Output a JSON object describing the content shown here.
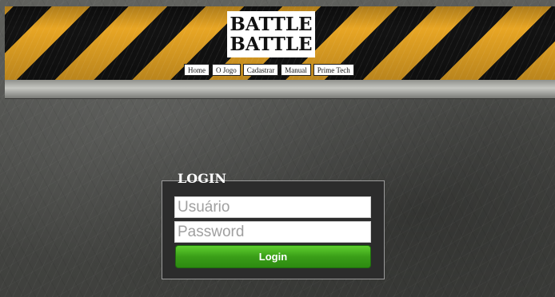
{
  "header": {
    "logo_line1": "BATTLE",
    "logo_line2": "BATTLE",
    "nav": [
      "Home",
      "O Jogo",
      "Cadastrar",
      "Manual",
      "Prime Tech"
    ],
    "stripe_colors": [
      "#e8a624",
      "#121212"
    ]
  },
  "login": {
    "title": "LOGIN",
    "username_placeholder": "Usuário",
    "password_placeholder": "Password",
    "button_label": "Login",
    "button_color": "#3a9e18"
  }
}
